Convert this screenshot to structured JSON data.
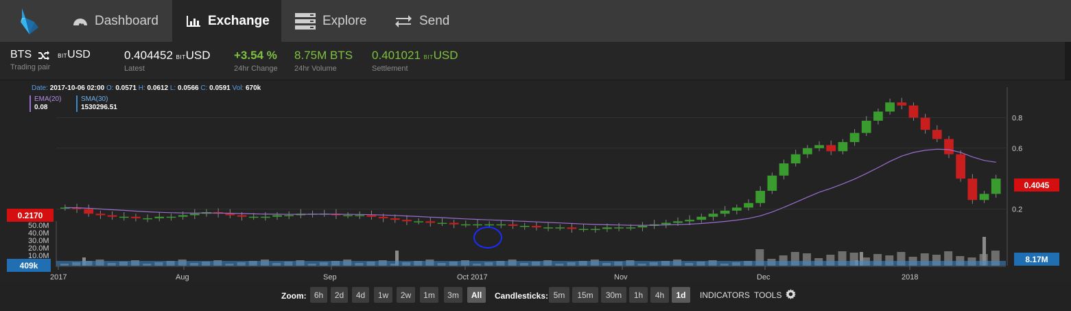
{
  "nav": {
    "tabs": [
      {
        "label": "Dashboard",
        "icon": "speedometer-icon"
      },
      {
        "label": "Exchange",
        "icon": "bar-chart-icon",
        "active": true
      },
      {
        "label": "Explore",
        "icon": "server-icon"
      },
      {
        "label": "Send",
        "icon": "transfer-arrows-icon"
      }
    ],
    "logo": "bitshares-logo"
  },
  "ticker": {
    "base": "BTS",
    "quote_prefix": "bit",
    "quote": "USD",
    "pair_label": "Trading pair",
    "latest_value": "0.404452",
    "latest_unit_prefix": "bit",
    "latest_unit": "USD",
    "latest_label": "Latest",
    "change_value": "+3.54 %",
    "change_label": "24hr Change",
    "volume_value": "8.75M BTS",
    "volume_label": "24hr Volume",
    "settlement_value": "0.401021",
    "settlement_unit_prefix": "bit",
    "settlement_unit": "USD",
    "settlement_label": "Settlement",
    "positive_color": "#7fc241"
  },
  "ohlc": {
    "date_label": "Date:",
    "date": "2017-10-06 02:00",
    "o_label": "O:",
    "o": "0.0571",
    "h_label": "H:",
    "h": "0.0612",
    "l_label": "L:",
    "l": "0.0566",
    "c_label": "C:",
    "c": "0.0591",
    "vol_label": "Vol:",
    "vol": "670k"
  },
  "indicators": {
    "ema_name": "EMA(20)",
    "ema_value": "0.08",
    "sma_name": "SMA(30)",
    "sma_value": "1530296.51"
  },
  "chart_data": {
    "type": "candlestick",
    "x_ticks": [
      "2017",
      "Aug",
      "Sep",
      "Oct 2017",
      "Nov",
      "Dec",
      "2018"
    ],
    "price_axis_ticks": [
      "0.8",
      "0.6",
      "0.2"
    ],
    "price_ylim": [
      0,
      1.0
    ],
    "volume_axis_ticks": [
      "50.0M",
      "40.0M",
      "30.0M",
      "20.0M",
      "10.0M"
    ],
    "current_price_tag": "0.4045",
    "left_price_tag": "0.2170",
    "current_volume_tag": "8.17M",
    "left_volume_tag": "409k",
    "up_color": "#3a9b2e",
    "down_color": "#c81e1e",
    "ema_color": "#9a6fd0",
    "sma_color": "#3b8ad0",
    "grid": true,
    "close_series": [
      0.21,
      0.2,
      0.17,
      0.16,
      0.15,
      0.15,
      0.14,
      0.14,
      0.15,
      0.15,
      0.16,
      0.17,
      0.18,
      0.17,
      0.16,
      0.15,
      0.15,
      0.15,
      0.16,
      0.16,
      0.17,
      0.17,
      0.17,
      0.16,
      0.16,
      0.16,
      0.15,
      0.14,
      0.13,
      0.12,
      0.12,
      0.11,
      0.11,
      0.1,
      0.1,
      0.1,
      0.1,
      0.1,
      0.09,
      0.09,
      0.08,
      0.08,
      0.08,
      0.07,
      0.07,
      0.07,
      0.08,
      0.08,
      0.08,
      0.09,
      0.1,
      0.11,
      0.12,
      0.13,
      0.15,
      0.17,
      0.19,
      0.21,
      0.24,
      0.32,
      0.42,
      0.5,
      0.56,
      0.6,
      0.62,
      0.58,
      0.64,
      0.7,
      0.78,
      0.84,
      0.9,
      0.88,
      0.8,
      0.72,
      0.66,
      0.56,
      0.4,
      0.26,
      0.3,
      0.4
    ]
  },
  "controls": {
    "zoom_label": "Zoom:",
    "zoom_options": [
      "6h",
      "2d",
      "4d",
      "1w",
      "2w",
      "1m",
      "3m",
      "All"
    ],
    "zoom_selected": "All",
    "candles_label": "Candlesticks:",
    "candle_options": [
      "5m",
      "15m",
      "30m",
      "1h",
      "4h",
      "1d"
    ],
    "candle_selected": "1d",
    "indicators_label": "INDICATORS",
    "tools_label": "TOOLS",
    "settings_icon": "gear-icon"
  }
}
